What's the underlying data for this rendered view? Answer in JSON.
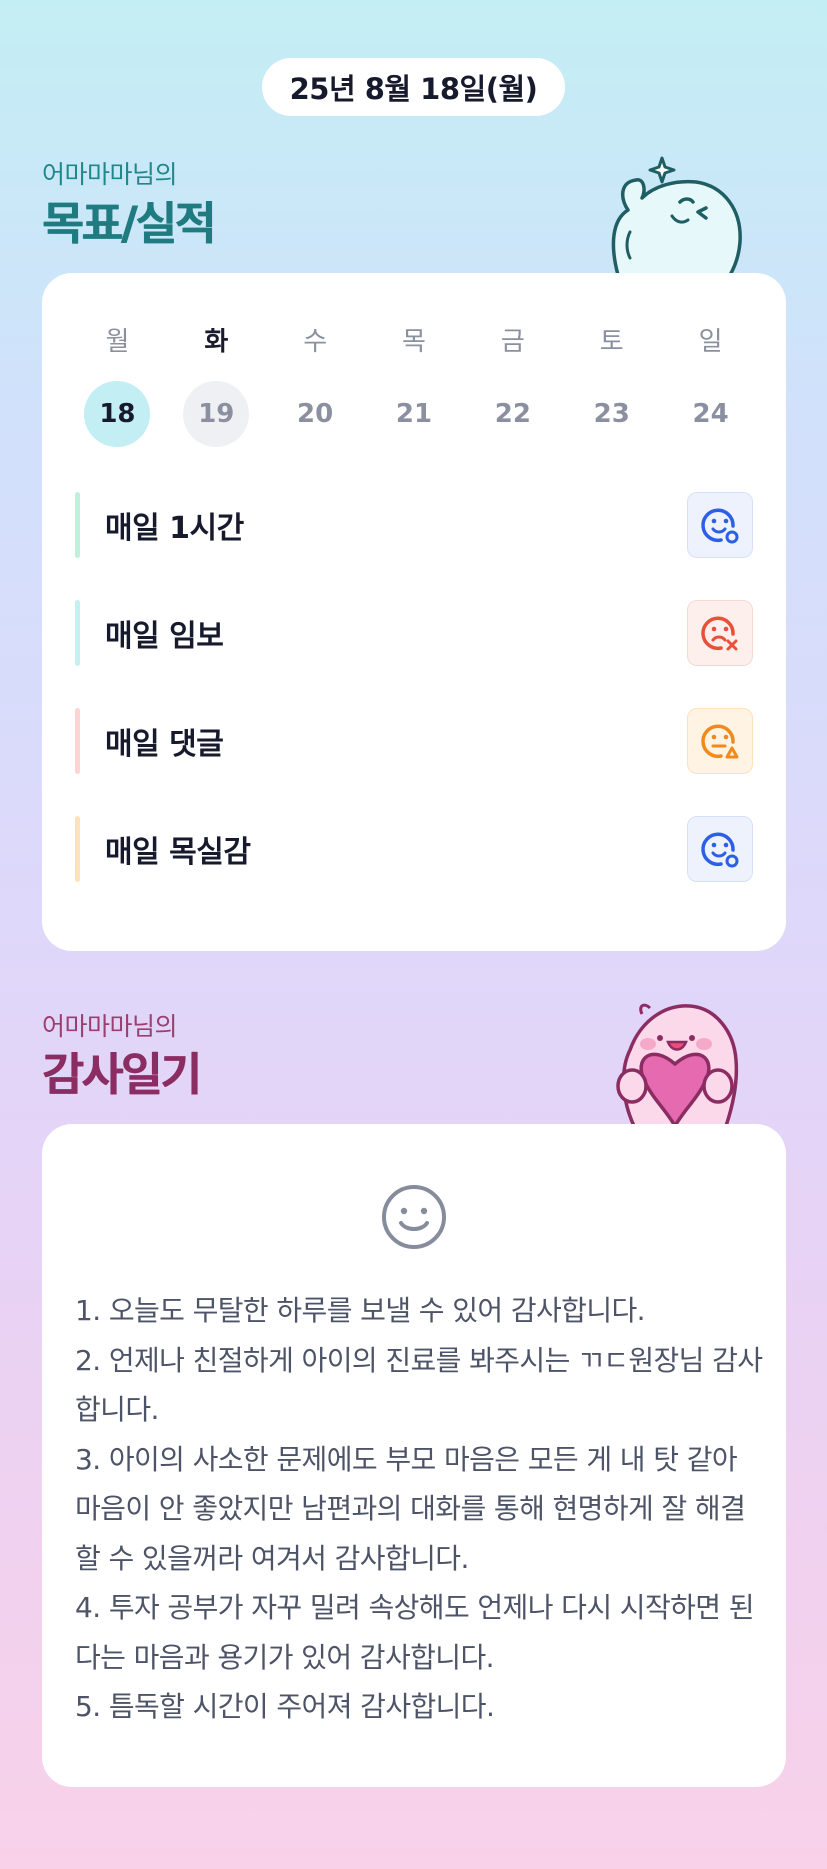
{
  "header": {
    "date": "25년 8월 18일(월)"
  },
  "goals_section": {
    "subtitle": "어마마마님의",
    "title": "목표/실적"
  },
  "calendar": {
    "weekdays": [
      "월",
      "화",
      "수",
      "목",
      "금",
      "토",
      "일"
    ],
    "days": [
      "18",
      "19",
      "20",
      "21",
      "22",
      "23",
      "24"
    ],
    "selected_day": "18"
  },
  "goals": [
    {
      "label": "매일 1시간",
      "status": "achieved",
      "bar_color": "#bff0de",
      "status_color": "#2d5fe6"
    },
    {
      "label": "매일 임보",
      "status": "failed",
      "bar_color": "#c5f0f2",
      "status_color": "#e8503a"
    },
    {
      "label": "매일 댓글",
      "status": "partial",
      "bar_color": "#ffd4d2",
      "status_color": "#f08a1d"
    },
    {
      "label": "매일 목실감",
      "status": "achieved",
      "bar_color": "#ffe1bc",
      "status_color": "#2d5fe6"
    }
  ],
  "diary_section": {
    "subtitle": "어마마마님의",
    "title": "감사일기"
  },
  "diary": {
    "mood_icon": "smile-icon",
    "lines": [
      "1. 오늘도 무탈한 하루를 보낼 수 있어 감사합니다.",
      "2. 언제나 친절하게 아이의 진료를 봐주시는 ㄲㄷ원장님 감사합니다.",
      "3. 아이의 사소한 문제에도 부모 마음은 모든 게 내 탓 같아 마음이 안 좋았지만 남편과의 대화를 통해 현명하게 잘 해결 할 수 있을꺼라 여겨서 감사합니다.",
      "4. 투자 공부가 자꾸 밀려 속상해도 언제나 다시 시작하면 된다는 마음과 용기가 있어 감사합니다.",
      "5. 틈독할 시간이 주어져 감사합니다."
    ]
  }
}
